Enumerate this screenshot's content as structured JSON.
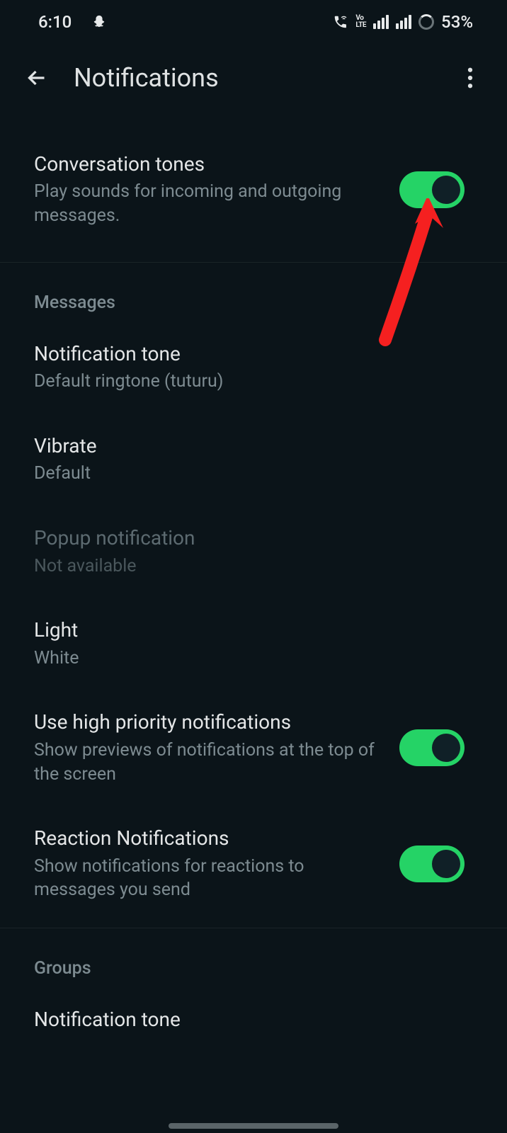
{
  "statusBar": {
    "time": "6:10",
    "battery": "53%"
  },
  "appBar": {
    "title": "Notifications"
  },
  "settings": {
    "conversationTones": {
      "title": "Conversation tones",
      "subtitle": "Play sounds for incoming and outgoing messages.",
      "enabled": true
    }
  },
  "sections": {
    "messages": {
      "header": "Messages",
      "notificationTone": {
        "title": "Notification tone",
        "subtitle": "Default ringtone (tuturu)"
      },
      "vibrate": {
        "title": "Vibrate",
        "subtitle": "Default"
      },
      "popup": {
        "title": "Popup notification",
        "subtitle": "Not available"
      },
      "light": {
        "title": "Light",
        "subtitle": "White"
      },
      "highPriority": {
        "title": "Use high priority notifications",
        "subtitle": "Show previews of notifications at the top of the screen",
        "enabled": true
      },
      "reactions": {
        "title": "Reaction Notifications",
        "subtitle": "Show notifications for reactions to messages you send",
        "enabled": true
      }
    },
    "groups": {
      "header": "Groups",
      "notificationTone": {
        "title": "Notification tone"
      }
    }
  }
}
